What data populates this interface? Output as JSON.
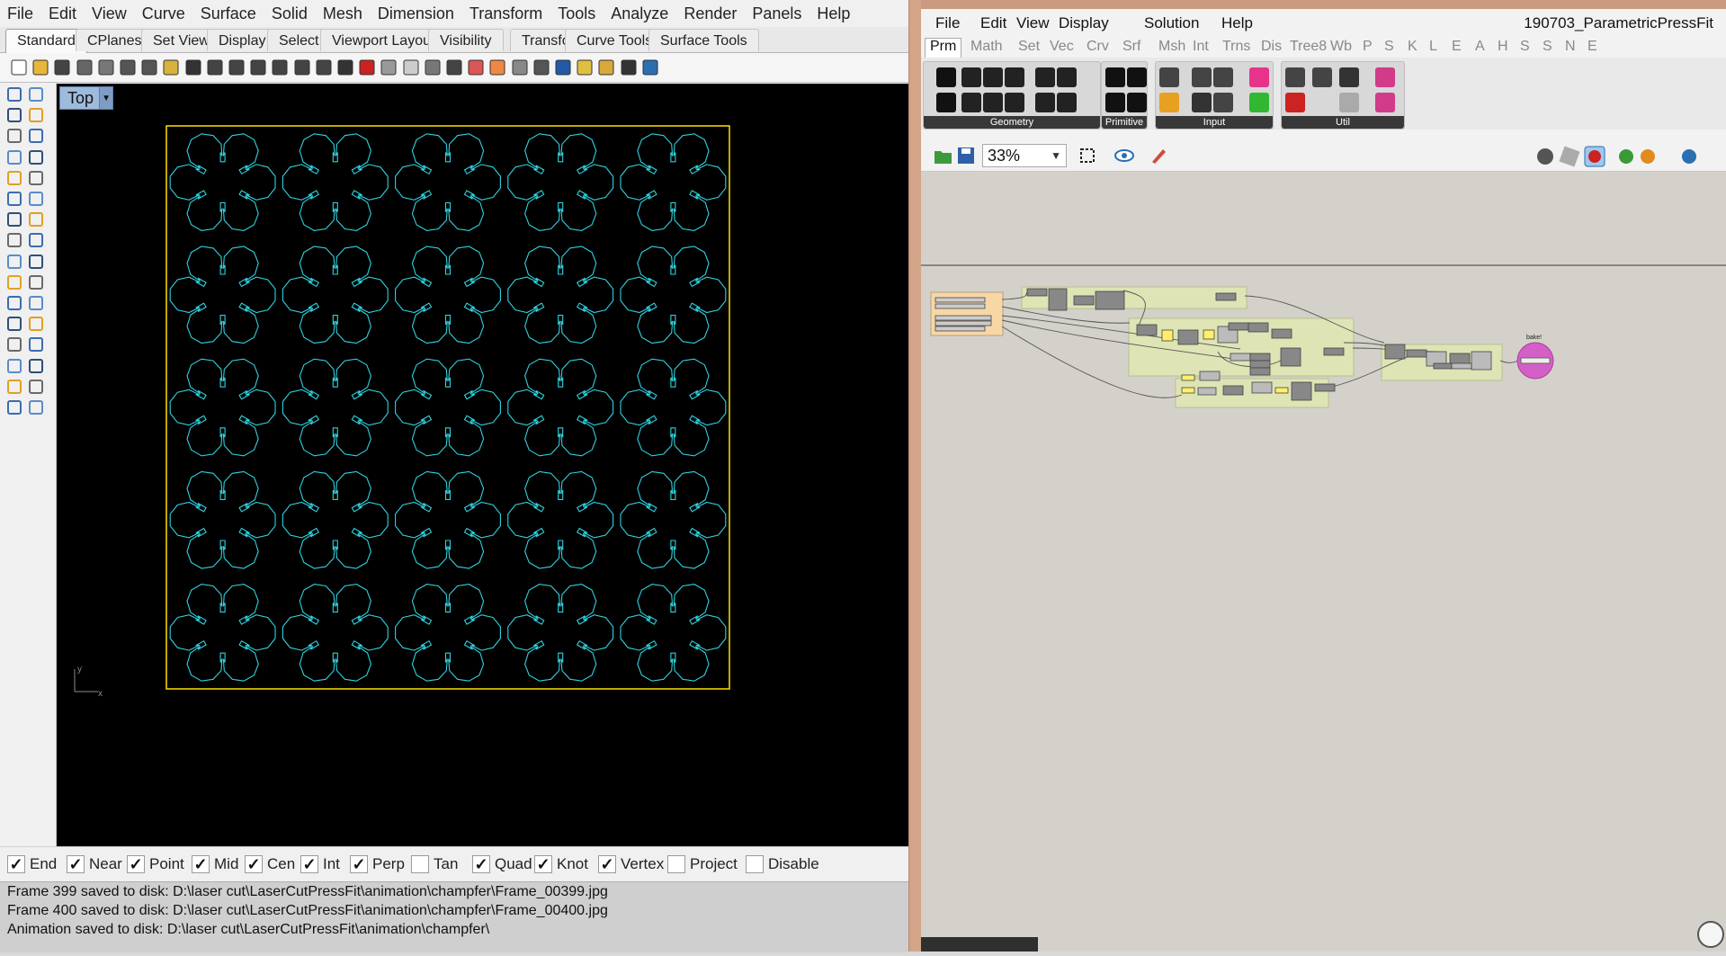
{
  "rhino": {
    "menu": [
      "File",
      "Edit",
      "View",
      "Curve",
      "Surface",
      "Solid",
      "Mesh",
      "Dimension",
      "Transform",
      "Tools",
      "Analyze",
      "Render",
      "Panels",
      "Help"
    ],
    "tabs": [
      "Standard",
      "CPlanes",
      "Set View",
      "Display",
      "Select",
      "Viewport Layout",
      "Visibility",
      "Transform",
      "Curve Tools",
      "Surface Tools"
    ],
    "active_tab": "Standard",
    "viewport": {
      "name": "Top",
      "axis_x": "x",
      "axis_y": "y"
    },
    "osnaps": [
      {
        "label": "End",
        "checked": true
      },
      {
        "label": "Near",
        "checked": true
      },
      {
        "label": "Point",
        "checked": true
      },
      {
        "label": "Mid",
        "checked": true
      },
      {
        "label": "Cen",
        "checked": true
      },
      {
        "label": "Int",
        "checked": true
      },
      {
        "label": "Perp",
        "checked": true
      },
      {
        "label": "Tan",
        "checked": false
      },
      {
        "label": "Quad",
        "checked": true
      },
      {
        "label": "Knot",
        "checked": true
      },
      {
        "label": "Vertex",
        "checked": true
      },
      {
        "label": "Project",
        "checked": false
      },
      {
        "label": "Disable",
        "checked": false
      }
    ],
    "command_history": [
      "Frame 399 saved to disk: D:\\laser cut\\LaserCutPressFit\\animation\\champfer\\Frame_00399.jpg",
      "Frame 400 saved to disk: D:\\laser cut\\LaserCutPressFit\\animation\\champfer\\Frame_00400.jpg",
      "Animation saved to disk: D:\\laser cut\\LaserCutPressFit\\animation\\champfer\\"
    ],
    "colors": {
      "curve": "#2fd3e0",
      "border": "#ffe000",
      "viewport_bg": "#000000",
      "viewport_label": "#9ebbdc"
    }
  },
  "grasshopper": {
    "menu": [
      "File",
      "Edit",
      "View",
      "Display",
      "Solution",
      "Help"
    ],
    "document": "190703_ParametricPressFit",
    "tabs": [
      "Prm",
      "Math",
      "Set",
      "Vec",
      "Crv",
      "Srf",
      "Msh",
      "Int",
      "Trns",
      "Dis",
      "Tree8",
      "Wb",
      "P",
      "S",
      "K",
      "L",
      "E",
      "A",
      "H",
      "S",
      "S",
      "N",
      "E"
    ],
    "active_tab": "Prm",
    "groups": [
      "Geometry",
      "Primitive",
      "Input",
      "Util"
    ],
    "zoom": "33%",
    "bake_label": "bake!",
    "colors": {
      "canvas": "#d4d1ca",
      "group": "#dfe4b5",
      "bake": "#d45fc6"
    }
  }
}
